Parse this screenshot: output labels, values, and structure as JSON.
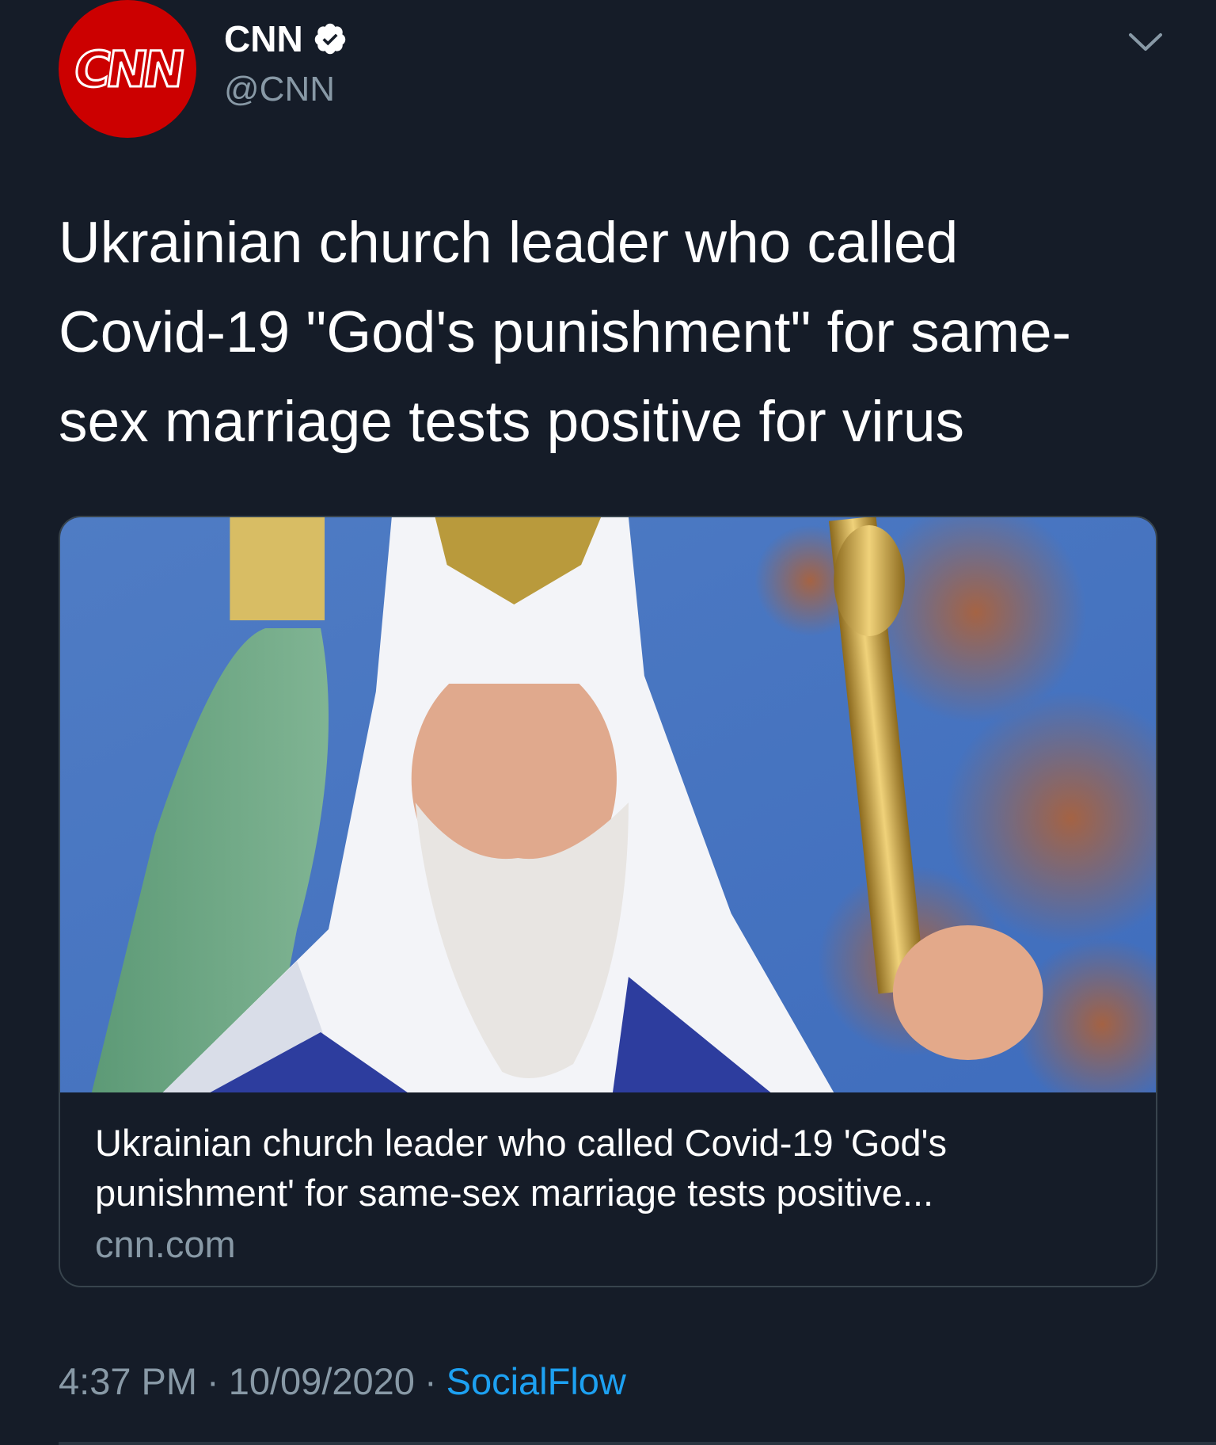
{
  "author": {
    "avatar_text": "CNN",
    "display_name": "CNN",
    "handle": "@CNN",
    "verified": true
  },
  "icons": {
    "verified": "verified-badge-icon",
    "menu": "chevron-down-icon"
  },
  "tweet": {
    "text": "Ukrainian church leader who called Covid-19 \"God's punishment\" for same-sex marriage tests positive for virus"
  },
  "card": {
    "title": "Ukrainian church leader who called Covid-19 'God's punishment' for same-sex marriage tests positive...",
    "domain": "cnn.com"
  },
  "meta": {
    "time": "4:37 PM",
    "sep1": "·",
    "date": "10/09/2020",
    "sep2": "·",
    "source": "SocialFlow"
  },
  "colors": {
    "background": "#151c28",
    "brand_red": "#cc0000",
    "secondary_text": "#8899a6",
    "link": "#1da1f2"
  }
}
